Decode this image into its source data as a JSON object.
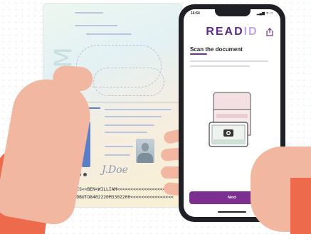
{
  "passport": {
    "signature": "J.Doe",
    "mrz_line1": "P<UTOJONES<<BEN<WILLIAM<<<<<<<<<<<<<<<<<<<",
    "mrz_line2": "1NVRIDRIDBUTO8402220M3302200<<<<<<<<<<<<<<<<"
  },
  "phone": {
    "status_time": "16:54",
    "status_icons": "▂▄▆ ᯤ ▭",
    "brand_read": "READ",
    "brand_id": "ID",
    "title": "Scan the document",
    "next_label": "Next"
  },
  "colors": {
    "brand_purple": "#7b2f8e",
    "sleeve": "#ee6a4d",
    "skin": "#f2b7a0"
  },
  "icons": [
    "share-icon",
    "camera-icon",
    "person-icon"
  ]
}
